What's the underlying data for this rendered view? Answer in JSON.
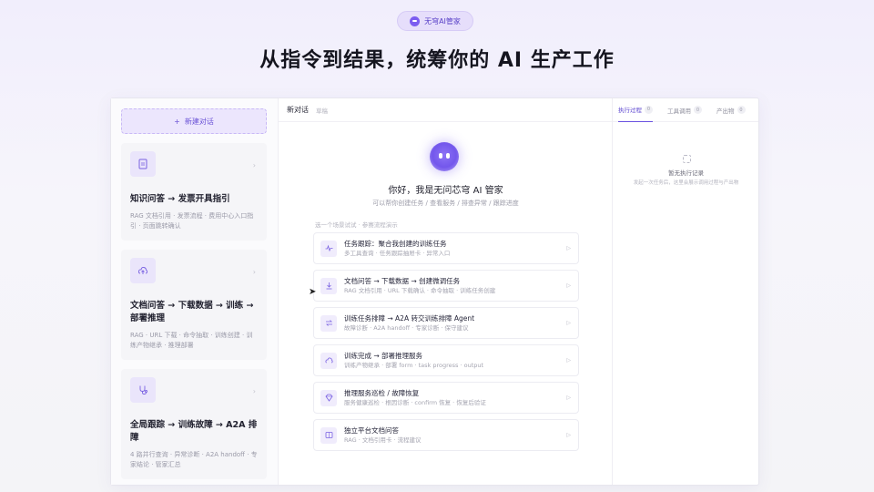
{
  "badge": {
    "label": "无穹AI管家"
  },
  "hero": {
    "title": "从指令到结果，统筹你的 AI 生产工作"
  },
  "sidebar": {
    "new_chat": {
      "label": "新建对话"
    },
    "cards": [
      {
        "title": "知识问答 → 发票开具指引",
        "desc": "RAG 文档引用 · 发票流程 · 费用中心入口指引 · 页面跳转确认",
        "icon": "document-icon"
      },
      {
        "title": "文档问答 → 下载数据 → 训练 → 部署推理",
        "desc": "RAG · URL 下载 · 命令抽取 · 训练创建 · 训练产物继承 · 推理部署",
        "icon": "cloud-upload-icon"
      },
      {
        "title": "全局跟踪 → 训练故障 → A2A 排障",
        "desc": "4 路并行查询 · 异常诊断 · A2A handoff · 专家结论 · 管家汇总",
        "icon": "stethoscope-icon"
      }
    ]
  },
  "main": {
    "header_title": "新对话",
    "header_sub": "草稿",
    "greeting": "你好，我是无问芯穹 AI 管家",
    "greeting_sub": "可以帮你创建任务 / 查看服务 / 排查异常 / 跟踪进度",
    "hint": "选一个场景试试 · 参赛流程演示",
    "tasks": [
      {
        "title": "任务跟踪：聚合我创建的训练任务",
        "desc": "多工具查询 · 任务跟踪抽屉卡 · 异常入口",
        "icon": "activity-icon"
      },
      {
        "title": "文档问答 → 下载数据 → 创建微调任务",
        "desc": "RAG 文档引用 · URL 下载确认 · 命令抽取 · 训练任务创建",
        "icon": "download-icon"
      },
      {
        "title": "训练任务排障 → A2A 转交训练排障 Agent",
        "desc": "故障诊断 · A2A handoff · 专家诊断 · 保守建议",
        "icon": "transfer-icon"
      },
      {
        "title": "训练完成 → 部署推理服务",
        "desc": "训练产物继承 · 部署 form · task progress · output",
        "icon": "deploy-icon"
      },
      {
        "title": "推理服务巡检 / 故障恢复",
        "desc": "服务健康巡检 · 根因诊断 · confirm 恢复 · 恢复后验证",
        "icon": "diamond-icon"
      },
      {
        "title": "独立平台文档问答",
        "desc": "RAG · 文档引用卡 · 流程建议",
        "icon": "book-icon"
      }
    ]
  },
  "right": {
    "tabs": [
      {
        "label": "执行过程",
        "count": "0"
      },
      {
        "label": "工具调用",
        "count": "0"
      },
      {
        "label": "产出物",
        "count": "0"
      }
    ],
    "empty_title": "暂无执行记录",
    "empty_desc": "发起一次任务后，这里会展示调用过程与产出物"
  },
  "colors": {
    "accent": "#6a52e0",
    "accent_soft": "#ece6fd"
  }
}
